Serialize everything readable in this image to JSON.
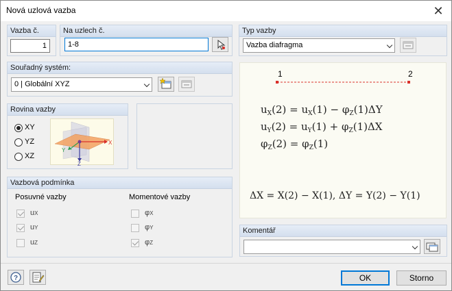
{
  "window": {
    "title": "Nová uzlová vazba"
  },
  "vazba": {
    "header": "Vazba č.",
    "value": "1"
  },
  "uzly": {
    "header": "Na uzlech č.",
    "value": "1-8"
  },
  "typ": {
    "header": "Typ vazby",
    "value": "Vazba diafragma"
  },
  "souradny": {
    "header": "Souřadný systém:",
    "value": "0 | Globální XYZ"
  },
  "rovina": {
    "header": "Rovina vazby",
    "options": [
      "XY",
      "YZ",
      "XZ"
    ],
    "selected": "XY"
  },
  "podminka": {
    "header": "Vazbová podmínka",
    "posuvne": {
      "label": "Posuvné vazby",
      "items": [
        {
          "base": "u",
          "sub": "X",
          "checked": true
        },
        {
          "base": "u",
          "sub": "Y",
          "checked": true
        },
        {
          "base": "u",
          "sub": "Z",
          "checked": false
        }
      ]
    },
    "momentove": {
      "label": "Momentové vazby",
      "items": [
        {
          "base": "φ",
          "sub": "X",
          "checked": false
        },
        {
          "base": "φ",
          "sub": "Y",
          "checked": false
        },
        {
          "base": "φ",
          "sub": "Z",
          "checked": true
        }
      ]
    }
  },
  "diagram": {
    "node1": "1",
    "node2": "2",
    "eq1": {
      "lhs": "u",
      "lhs_sub": "X",
      "arg": "(2) = u",
      "rhs_sub": "X",
      "tail": "(1) − φ",
      "tail_sub": "Z",
      "tail2": "(1)ΔY"
    },
    "eq2": {
      "lhs": "u",
      "lhs_sub": "Y",
      "arg": "(2) = u",
      "rhs_sub": "Y",
      "tail": "(1) + φ",
      "tail_sub": "Z",
      "tail2": "(1)ΔX"
    },
    "eq3": {
      "lhs": "φ",
      "lhs_sub": "Z",
      "arg": "(2) = φ",
      "rhs_sub": "Z",
      "tail": "(1)"
    },
    "bottom": "ΔX = X(2) − X(1), ΔY = Y(2) − Y(1)",
    "axes": {
      "x": "X",
      "y": "Y",
      "z": "Z"
    }
  },
  "komentar": {
    "header": "Komentář",
    "value": ""
  },
  "buttons": {
    "ok": "OK",
    "cancel": "Storno"
  },
  "colors": {
    "accent": "#0078d7",
    "node": "#d9312b",
    "plane": "#f4a261"
  }
}
